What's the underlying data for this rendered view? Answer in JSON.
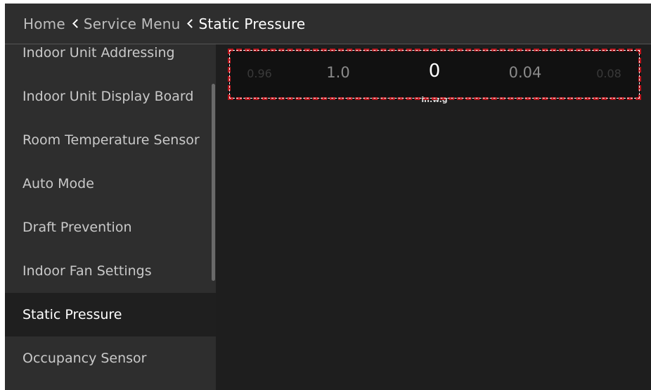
{
  "breadcrumb": {
    "home": "Home",
    "service_menu": "Service Menu",
    "current": "Static Pressure"
  },
  "sidebar": {
    "items": [
      {
        "label": "Indoor Unit Addressing"
      },
      {
        "label": "Indoor Unit Display Board"
      },
      {
        "label": "Room Temperature Sensor"
      },
      {
        "label": "Auto Mode"
      },
      {
        "label": "Draft Prevention"
      },
      {
        "label": "Indoor Fan Settings"
      },
      {
        "label": "Static Pressure",
        "active": true
      },
      {
        "label": "Occupancy Sensor"
      }
    ]
  },
  "picker": {
    "values": [
      "0.96",
      "1.0",
      "0",
      "0.04",
      "0.08"
    ],
    "selected_index": 2,
    "unit": "in.w.g"
  },
  "colors": {
    "background": "#1e1e1e",
    "header": "#2e2e2e",
    "focus_border": "#b8141b"
  },
  "icons": [
    "chevron-left-icon"
  ]
}
